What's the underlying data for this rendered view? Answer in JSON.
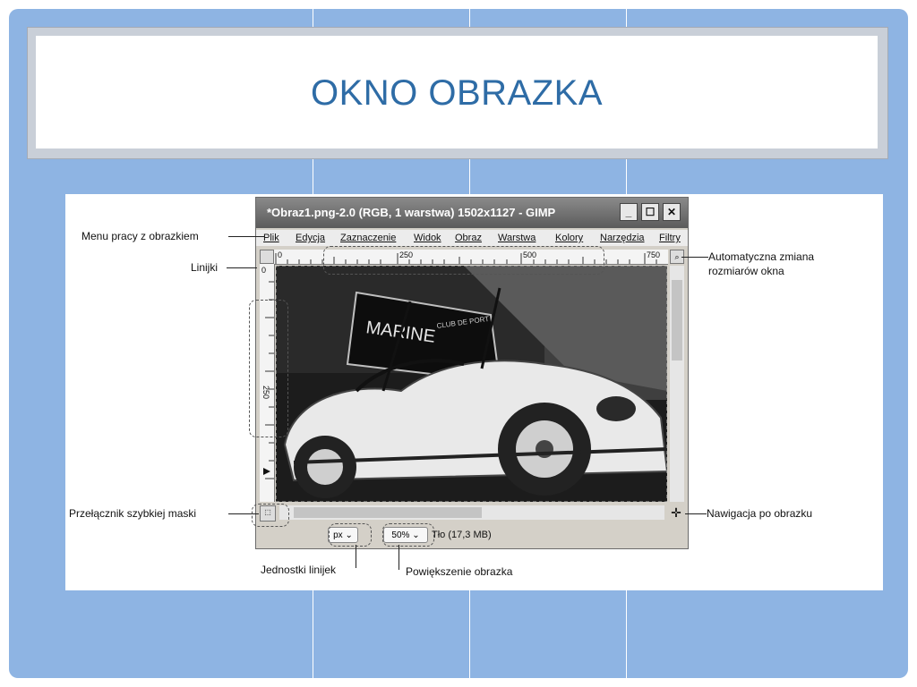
{
  "slide": {
    "title": "OKNO OBRAZKA"
  },
  "gimp_window": {
    "title": "*Obraz1.png-2.0 (RGB, 1 warstwa) 1502x1127 - GIMP",
    "window_buttons": [
      "_",
      "☐",
      "✕"
    ],
    "menu": [
      "Plik",
      "Edycja",
      "Zaznaczenie",
      "Widok",
      "Obraz",
      "Warstwa",
      "Kolory",
      "Narzędzia",
      "Filtry"
    ],
    "ruler_ticks": [
      "0",
      "250",
      "500",
      "750"
    ],
    "vertical_ruler_ticks": [
      "0",
      "250"
    ],
    "canvas_text": {
      "banner": "MARINE",
      "subtitle": "CLUB DE PORT"
    },
    "units_value": "px",
    "zoom_value": "50%",
    "status": "Tło (17,3 MB)"
  },
  "callouts": {
    "menu": "Menu pracy z obrazkiem",
    "rulers": "Linijki",
    "auto_resize": "Automatyczna zmiana rozmiarów okna",
    "quick_mask": "Przełącznik szybkiej maski",
    "navigation": "Nawigacja po obrazku",
    "ruler_units": "Jednostki linijek",
    "zoom": "Powiększenie obrazka"
  },
  "colors": {
    "slide_background": "#8eb4e3",
    "title_color": "#2e6ca6",
    "title_frame": "#c9cfd8"
  }
}
